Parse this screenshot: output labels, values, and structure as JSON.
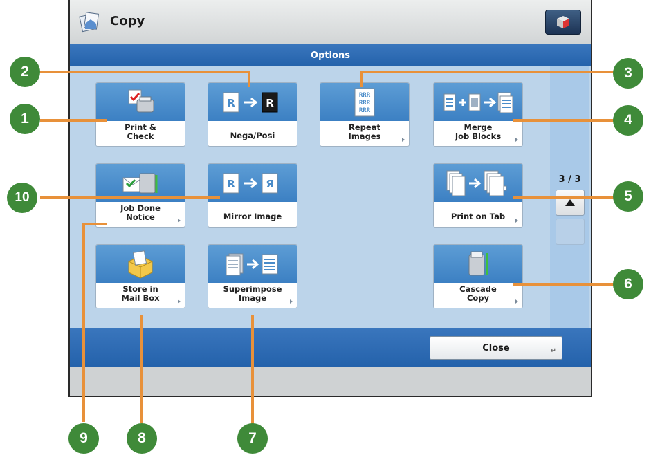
{
  "header": {
    "title": "Copy"
  },
  "options_bar": {
    "title": "Options"
  },
  "buttons": {
    "print_check": "Print &\nCheck",
    "nega_posi": "Nega/Posi",
    "repeat_images": "Repeat\nImages",
    "merge_job_blocks": "Merge\nJob Blocks",
    "job_done_notice": "Job Done\nNotice",
    "mirror_image": "Mirror Image",
    "print_on_tab": "Print on Tab",
    "store_in_mail_box": "Store in\nMail Box",
    "superimpose_image": "Superimpose\nImage",
    "cascade_copy": "Cascade\nCopy"
  },
  "icon_letters": {
    "r": "R",
    "r_mirror": "Я",
    "rrr": "RRR"
  },
  "pager": {
    "text": "3 / 3"
  },
  "close": {
    "label": "Close"
  },
  "callouts": {
    "c1": "1",
    "c2": "2",
    "c3": "3",
    "c4": "4",
    "c5": "5",
    "c6": "6",
    "c7": "7",
    "c8": "8",
    "c9": "9",
    "c10": "10"
  },
  "colors": {
    "accent": "#2462ab",
    "callout": "#3f8a39",
    "leader": "#e8913a",
    "tile": "#4a8cc9"
  }
}
